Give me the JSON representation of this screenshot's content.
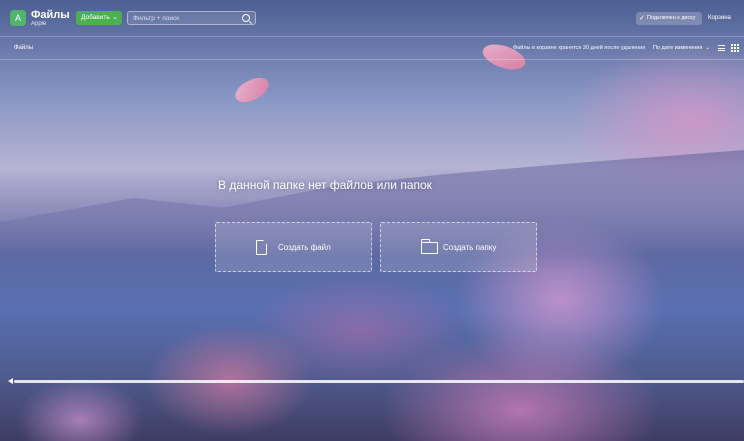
{
  "header": {
    "logo_letter": "A",
    "title": "Файлы",
    "subtitle": "Apple",
    "add_button": "Добавить",
    "search_placeholder": "Фильтр + поиск",
    "disk_button": "Подключен к диску",
    "cart_button": "Корзина"
  },
  "subbar": {
    "breadcrumb": "Файлы",
    "trash_notice": "Файлы в корзине хранятся 30 дней после удаления",
    "sort_label": "По дате изменения"
  },
  "main": {
    "empty_message": "В данной папке нет файлов или папок",
    "create_file": "Создать файл",
    "create_folder": "Создать папку"
  },
  "colors": {
    "accent_green": "#4caf50"
  }
}
